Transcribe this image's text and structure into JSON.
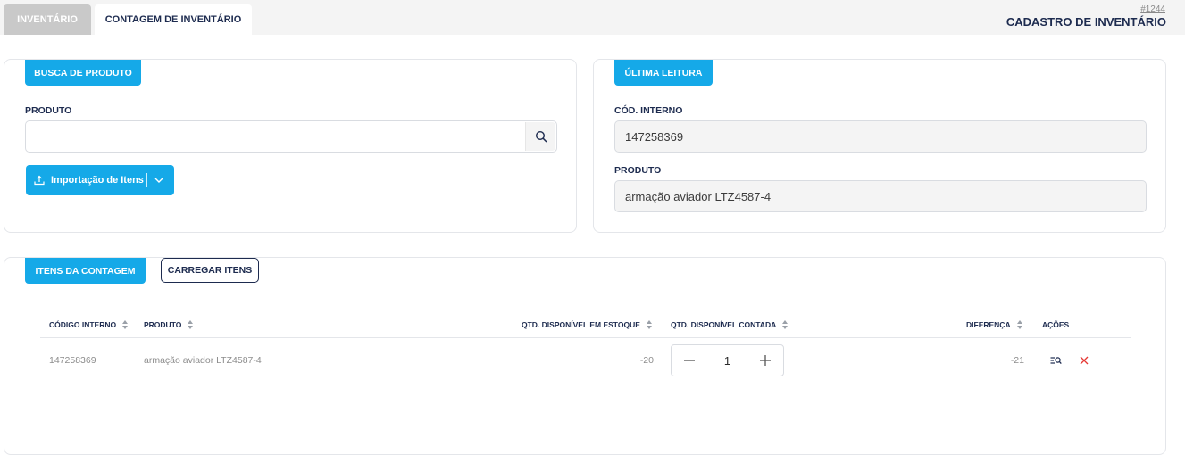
{
  "tabs": [
    {
      "label": "INVENTÁRIO",
      "active": false
    },
    {
      "label": "CONTAGEM DE INVENTÁRIO",
      "active": true
    }
  ],
  "header": {
    "id": "#1244",
    "title": "CADASTRO DE INVENTÁRIO"
  },
  "busca": {
    "section_label": "BUSCA DE PRODUTO",
    "produto_label": "PRODUTO",
    "produto_value": "",
    "import_label": "Importação de Itens",
    "icons": {
      "search": "search-icon",
      "upload": "upload-icon",
      "dropdown": "chevron-down-icon"
    }
  },
  "ultima": {
    "section_label": "ÚLTIMA LEITURA",
    "cod_label": "CÓD. INTERNO",
    "cod_value": "147258369",
    "produto_label": "PRODUTO",
    "produto_value": "armação aviador LTZ4587-4"
  },
  "itens": {
    "section_label": "ITENS DA CONTAGEM",
    "carregar_label": "CARREGAR ITENS",
    "columns": [
      "CÓDIGO INTERNO",
      "PRODUTO",
      "QTD. DISPONÍVEL EM ESTOQUE",
      "QTD. DISPONÍVEL CONTADA",
      "DIFERENÇA",
      "AÇÕES"
    ],
    "rows": [
      {
        "codigo": "147258369",
        "produto": "armação aviador LTZ4587-4",
        "estoque": "-20",
        "contada": "1",
        "diferenca": "-21"
      }
    ]
  },
  "colors": {
    "primary": "#15a9e8",
    "navy": "#1d2b4f",
    "danger": "#e53935"
  }
}
